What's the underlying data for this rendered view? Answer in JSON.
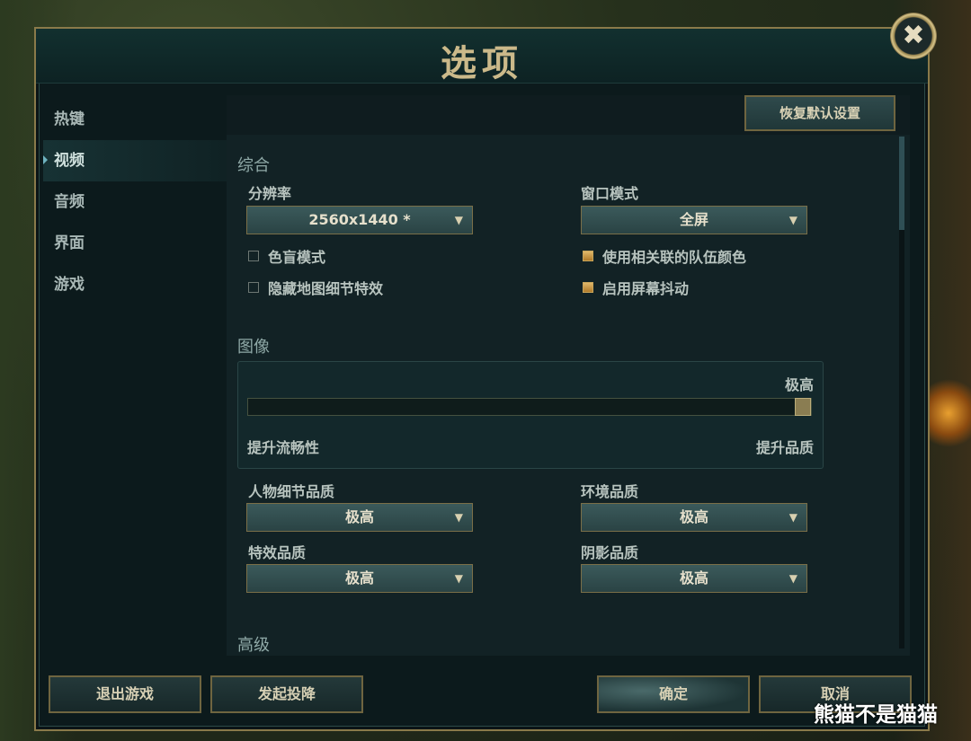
{
  "dialog": {
    "title": "选项",
    "close_glyph": "✖"
  },
  "sidebar": {
    "items": [
      {
        "label": "热键",
        "active": false
      },
      {
        "label": "视频",
        "active": true
      },
      {
        "label": "音频",
        "active": false
      },
      {
        "label": "界面",
        "active": false
      },
      {
        "label": "游戏",
        "active": false
      }
    ]
  },
  "toolbar": {
    "reset_label": "恢复默认设置"
  },
  "general": {
    "title": "综合",
    "resolution": {
      "label": "分辨率",
      "value": "2560x1440 *"
    },
    "window_mode": {
      "label": "窗口模式",
      "value": "全屏"
    },
    "checkboxes": [
      {
        "label": "色盲模式",
        "checked": false
      },
      {
        "label": "隐藏地图细节特效",
        "checked": false
      },
      {
        "label": "使用相关联的队伍颜色",
        "checked": true
      },
      {
        "label": "启用屏幕抖动",
        "checked": true
      }
    ]
  },
  "graphics": {
    "title": "图像",
    "level_label": "极高",
    "left_label": "提升流畅性",
    "right_label": "提升品质",
    "slider_value": 1.0,
    "settings": [
      {
        "label": "人物细节品质",
        "value": "极高"
      },
      {
        "label": "环境品质",
        "value": "极高"
      },
      {
        "label": "特效品质",
        "value": "极高"
      },
      {
        "label": "阴影品质",
        "value": "极高"
      }
    ]
  },
  "advanced": {
    "title": "高级"
  },
  "footer": {
    "exit_label": "退出游戏",
    "surrender_label": "发起投降",
    "ok_label": "确定",
    "cancel_label": "取消"
  },
  "watermark": "熊猫不是猫猫",
  "colors": {
    "gold": "#cbb98a",
    "teal_bg": "#0c1a1c",
    "checked": "#e0b86a"
  }
}
